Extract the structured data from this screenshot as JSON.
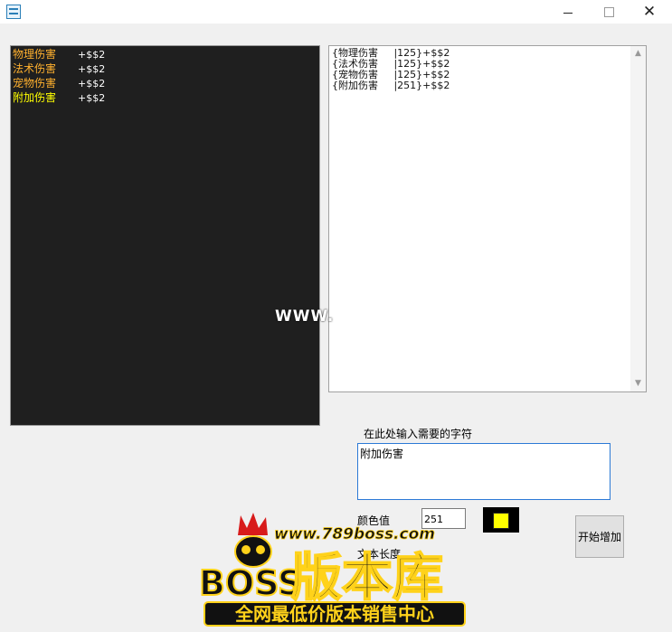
{
  "window": {
    "title_icon": "app-icon",
    "controls": [
      "minimize",
      "maximize",
      "close"
    ]
  },
  "preview": {
    "items": [
      {
        "name": "物理伤害",
        "value": "+$$2",
        "color": "#ffb02e"
      },
      {
        "name": "法术伤害",
        "value": "+$$2",
        "color": "#ffb02e"
      },
      {
        "name": "宠物伤害",
        "value": "+$$2",
        "color": "#ffb02e"
      },
      {
        "name": "附加伤害",
        "value": "+$$2",
        "color": "#ffff00"
      }
    ]
  },
  "code_list": {
    "lines": [
      "{物理伤害     |125}+$$2",
      "{法术伤害     |125}+$$2",
      "{宠物伤害     |125}+$$2",
      "{附加伤害     |251}+$$2"
    ]
  },
  "watermark": "WWW.",
  "input": {
    "label": "在此处输入需要的字符",
    "value": "附加伤害"
  },
  "color": {
    "label": "颜色值",
    "value": "251",
    "swatch": "#ffff00"
  },
  "length": {
    "label": "文本长度"
  },
  "actions": {
    "start": "开始增加"
  },
  "logo": {
    "url": "www.789boss.com",
    "boss": "BOSS",
    "brand": "版本库",
    "slogan": "全网最低价版本销售中心"
  }
}
